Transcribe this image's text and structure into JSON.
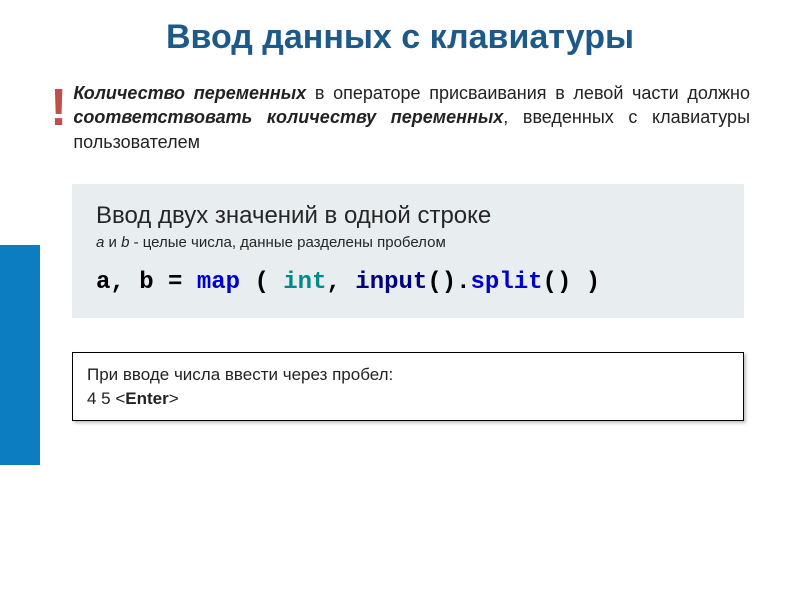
{
  "title": "Ввод данных с клавиатуры",
  "exclaim": "!",
  "note": {
    "seg1": "Количество переменных",
    "seg2": " в операторе присваивания в левой части должно ",
    "seg3": "соответствовать количеству переменных",
    "seg4": ", введенных с клавиатуры пользователем"
  },
  "example": {
    "title": "Ввод двух значений в одной строке",
    "sub_prefix_ital": "a",
    "sub_and": " и ",
    "sub_b_ital": "b",
    "sub_tail": " - целые числа, данные разделены пробелом",
    "code": {
      "p1": "a, b = ",
      "p2": "map",
      "p3": " ( ",
      "p4": "int",
      "p5": ", ",
      "p6": "input",
      "p7": "().",
      "p8": "split",
      "p9": "() )"
    }
  },
  "inputexample": {
    "line1": "При вводе числа ввести через пробел:",
    "line2_prefix": "4  5  <",
    "line2_key": "Enter",
    "line2_suffix": ">"
  }
}
